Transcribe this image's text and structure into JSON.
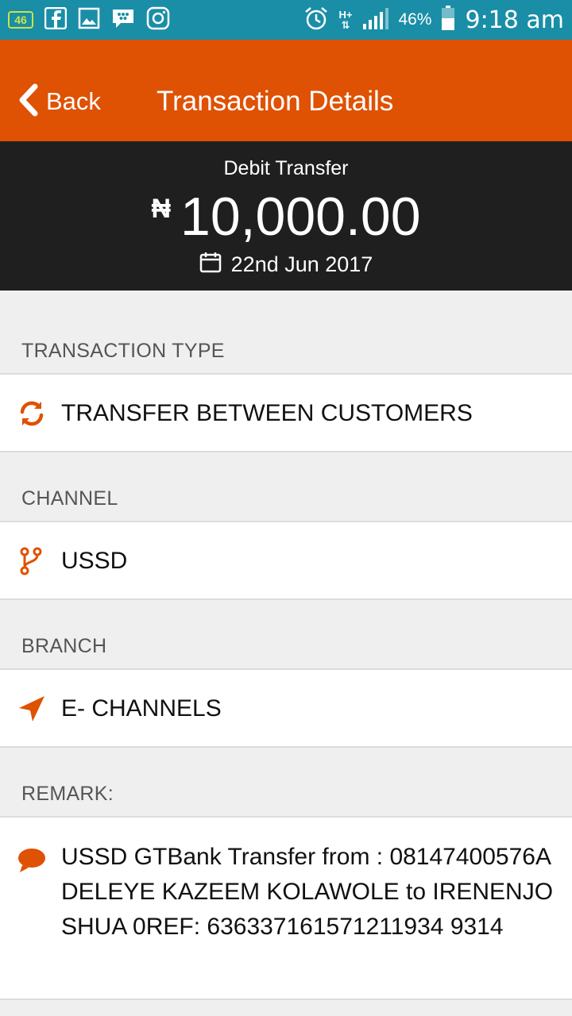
{
  "status_bar": {
    "badge": "46",
    "network": "H+",
    "battery_percent": "46%",
    "time": "9:18 am",
    "icons": [
      "sim-badge-icon",
      "facebook-icon",
      "gallery-icon",
      "bbm-icon",
      "instagram-icon",
      "alarm-icon",
      "hplus-icon",
      "signal-icon",
      "battery-icon"
    ]
  },
  "header": {
    "back_label": "Back",
    "title": "Transaction Details",
    "color": "#df5103"
  },
  "summary": {
    "type": "Debit Transfer",
    "currency": "₦",
    "amount": "10,000.00",
    "date": "22nd Jun 2017"
  },
  "sections": {
    "transaction_type": {
      "label": "TRANSACTION TYPE",
      "value": "TRANSFER BETWEEN CUSTOMERS",
      "icon": "refresh-icon"
    },
    "channel": {
      "label": "CHANNEL",
      "value": "USSD",
      "icon": "branch-icon"
    },
    "branch": {
      "label": "BRANCH",
      "value": "E- CHANNELS",
      "icon": "location-arrow-icon"
    },
    "remark": {
      "label": "REMARK:",
      "value": "USSD GTBank Transfer from : 08147400576ADELEYE KAZEEM KOLAWOLE to IRENENJOSHUA 0REF: 636337161571211934 9314",
      "icon": "chat-icon"
    }
  },
  "colors": {
    "accent": "#df5103",
    "status_bar": "#1a8ea6",
    "hero": "#1f1f1f",
    "background": "#efefef"
  }
}
